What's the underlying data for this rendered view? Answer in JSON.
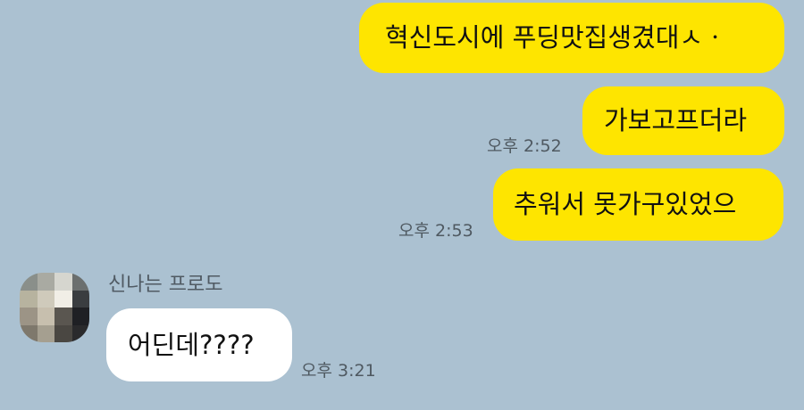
{
  "chat": {
    "messages": [
      {
        "id": "m1",
        "side": "mine",
        "text": "혁신도시에 푸딩맛집생겼대ㅅㆍ",
        "time": ""
      },
      {
        "id": "m2",
        "side": "mine",
        "text": "가보고프더라",
        "time": "오후 2:52"
      },
      {
        "id": "m3",
        "side": "mine",
        "text": "추워서 못가구있었으",
        "time": "오후 2:53"
      },
      {
        "id": "m4",
        "side": "theirs",
        "sender": "신나는 프로도",
        "text": "어딘데????",
        "time": "오후 3:21"
      }
    ]
  },
  "colors": {
    "background": "#abc1d1",
    "my_bubble": "#fee500",
    "their_bubble": "#ffffff",
    "time_text": "#4f5961",
    "sender_text": "#505a63"
  },
  "avatar": {
    "icon": "pixelated-profile-photo-icon",
    "pixel_colors": [
      "#8a8f8a",
      "#a9aaa2",
      "#d6d6cf",
      "#6b6f6e",
      "#b7b39f",
      "#cfcabb",
      "#f1eee6",
      "#3a3d40",
      "#9c9486",
      "#c7bfae",
      "#5a5650",
      "#1f2024",
      "#7e786c",
      "#a59f90",
      "#4a4742",
      "#2a2a2c"
    ]
  }
}
